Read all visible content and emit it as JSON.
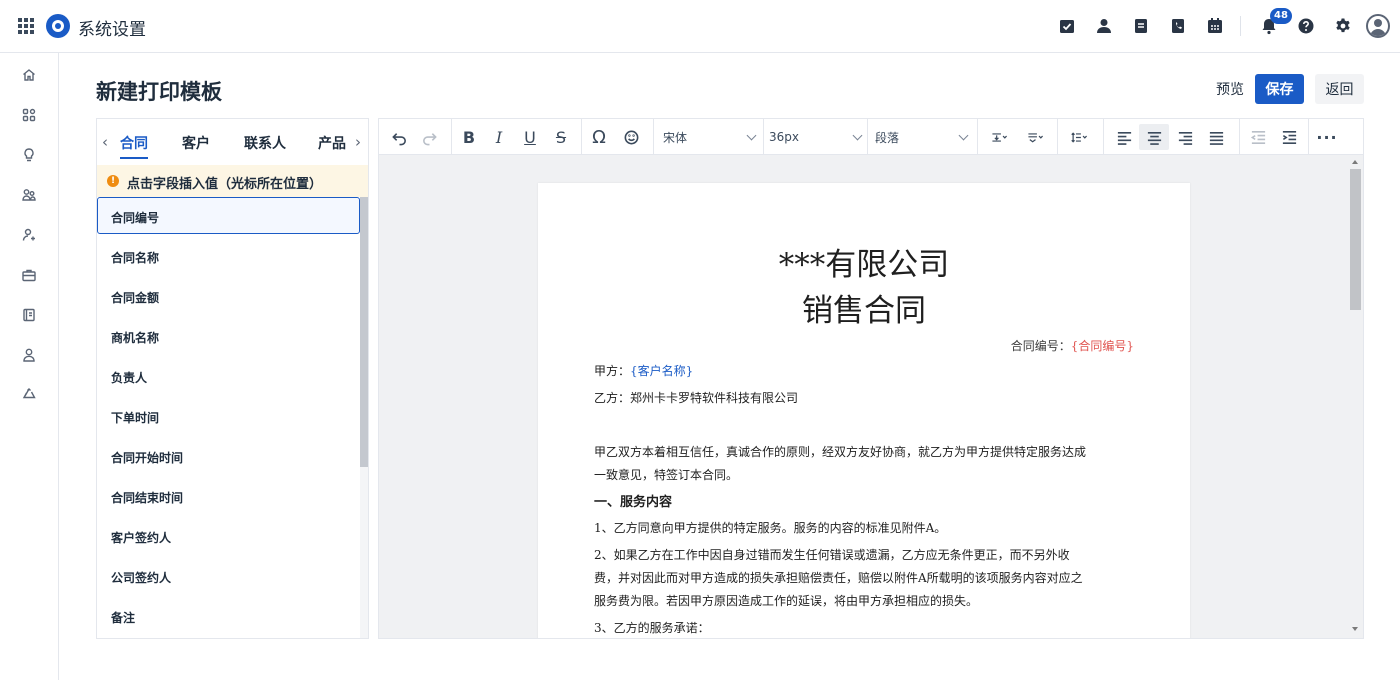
{
  "app": {
    "title": "系统设置"
  },
  "topbar": {
    "notification_count": "48"
  },
  "header": {
    "title": "新建打印模板",
    "preview_label": "预览",
    "save_label": "保存",
    "back_label": "返回"
  },
  "field_panel": {
    "tabs": [
      "合同",
      "客户",
      "联系人",
      "产品"
    ],
    "active_tab": "合同",
    "tip": "点击字段插入值（光标所在位置）",
    "fields": [
      "合同编号",
      "合同名称",
      "合同金额",
      "商机名称",
      "负责人",
      "下单时间",
      "合同开始时间",
      "合同结束时间",
      "客户签约人",
      "公司签约人",
      "备注"
    ],
    "selected_field": "合同编号"
  },
  "toolbar": {
    "font_family": "宋体",
    "font_size": "36px",
    "block_type": "段落"
  },
  "document": {
    "title_line1": "***有限公司",
    "title_line2": "销售合同",
    "contract_no_label": "合同编号：",
    "contract_no_placeholder": "{合同编号}",
    "party_a_label": "甲方：",
    "party_a_placeholder": "{客户名称}",
    "party_b": "乙方：郑州卡卡罗特软件科技有限公司",
    "intro_line1": "甲乙双方本着相互信任，真诚合作的原则，经双方友好协商，就乙方为甲方提供特定服务达成",
    "intro_line2": "一致意见，特签订本合同。",
    "section1": "一、服务内容",
    "item1": "1、乙方同意向甲方提供的特定服务。服务的内容的标准见附件A。",
    "item2_line1": "2、如果乙方在工作中因自身过错而发生任何错误或遗漏，乙方应无条件更正，而不另外收",
    "item2_line2": "费，并对因此而对甲方造成的损失承担赔偿责任，赔偿以附件A所载明的该项服务内容对应之",
    "item2_line3": "服务费为限。若因甲方原因造成工作的延误，将由甲方承担相应的损失。",
    "item3": "3、乙方的服务承诺："
  },
  "colors": {
    "primary": "#1a5bc6",
    "placeholder_red": "#e0534f",
    "tip_bg": "#fdf6e4",
    "tip_icon": "#ef8c10"
  }
}
